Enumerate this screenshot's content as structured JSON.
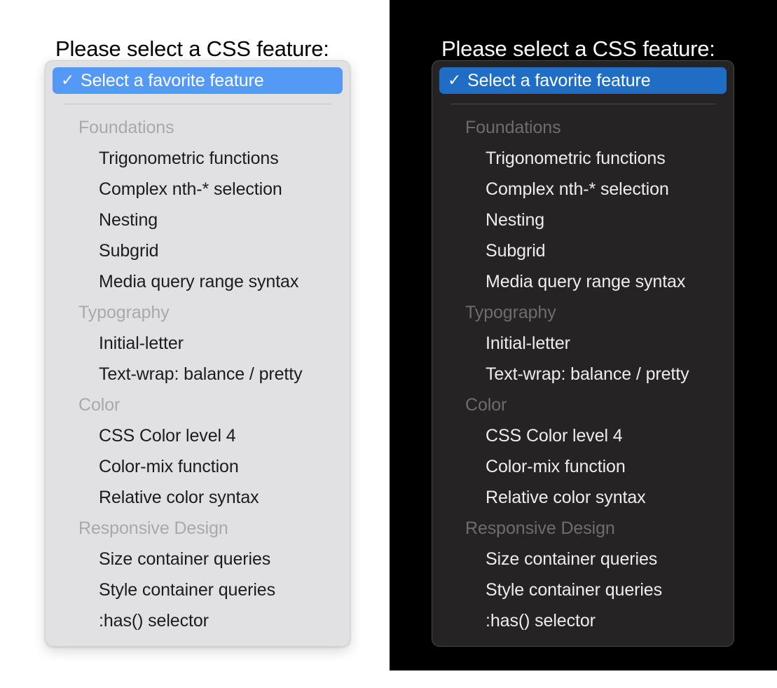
{
  "panels": [
    {
      "theme": "light",
      "prompt": "Please select a CSS feature:",
      "selected": {
        "check_icon": "✓",
        "label": "Select a favorite feature"
      },
      "groups": [
        {
          "label": "Foundations",
          "items": [
            "Trigonometric functions",
            "Complex nth-* selection",
            "Nesting",
            "Subgrid",
            "Media query range syntax"
          ]
        },
        {
          "label": "Typography",
          "items": [
            "Initial-letter",
            "Text-wrap: balance / pretty"
          ]
        },
        {
          "label": "Color",
          "items": [
            "CSS Color level 4",
            "Color-mix function",
            "Relative color syntax"
          ]
        },
        {
          "label": "Responsive Design",
          "items": [
            "Size container queries",
            "Style container queries",
            ":has() selector"
          ]
        }
      ]
    },
    {
      "theme": "dark",
      "prompt": "Please select a CSS feature:",
      "selected": {
        "check_icon": "✓",
        "label": "Select a favorite feature"
      },
      "groups": [
        {
          "label": "Foundations",
          "items": [
            "Trigonometric functions",
            "Complex nth-* selection",
            "Nesting",
            "Subgrid",
            "Media query range syntax"
          ]
        },
        {
          "label": "Typography",
          "items": [
            "Initial-letter",
            "Text-wrap: balance / pretty"
          ]
        },
        {
          "label": "Color",
          "items": [
            "CSS Color level 4",
            "Color-mix function",
            "Relative color syntax"
          ]
        },
        {
          "label": "Responsive Design",
          "items": [
            "Size container queries",
            "Style container queries",
            ":has() selector"
          ]
        }
      ]
    }
  ],
  "colors": {
    "light_panel_bg": "#e1e1e3",
    "light_panel_border": "#d2d2d4",
    "light_accent": "#5599f7",
    "light_group_label": "#a9a9ab",
    "light_item_text": "#1c1c1e",
    "light_separator": "#c6c6c8",
    "dark_canvas_bg": "#000000",
    "dark_panel_bg": "#262324",
    "dark_panel_border": "#4b4849",
    "dark_accent": "#1f6dc4",
    "dark_group_label": "#6f6c6d",
    "dark_item_text": "#ededed",
    "dark_separator": "#4e4b4c",
    "light_canvas_bg": "#ffffff"
  }
}
